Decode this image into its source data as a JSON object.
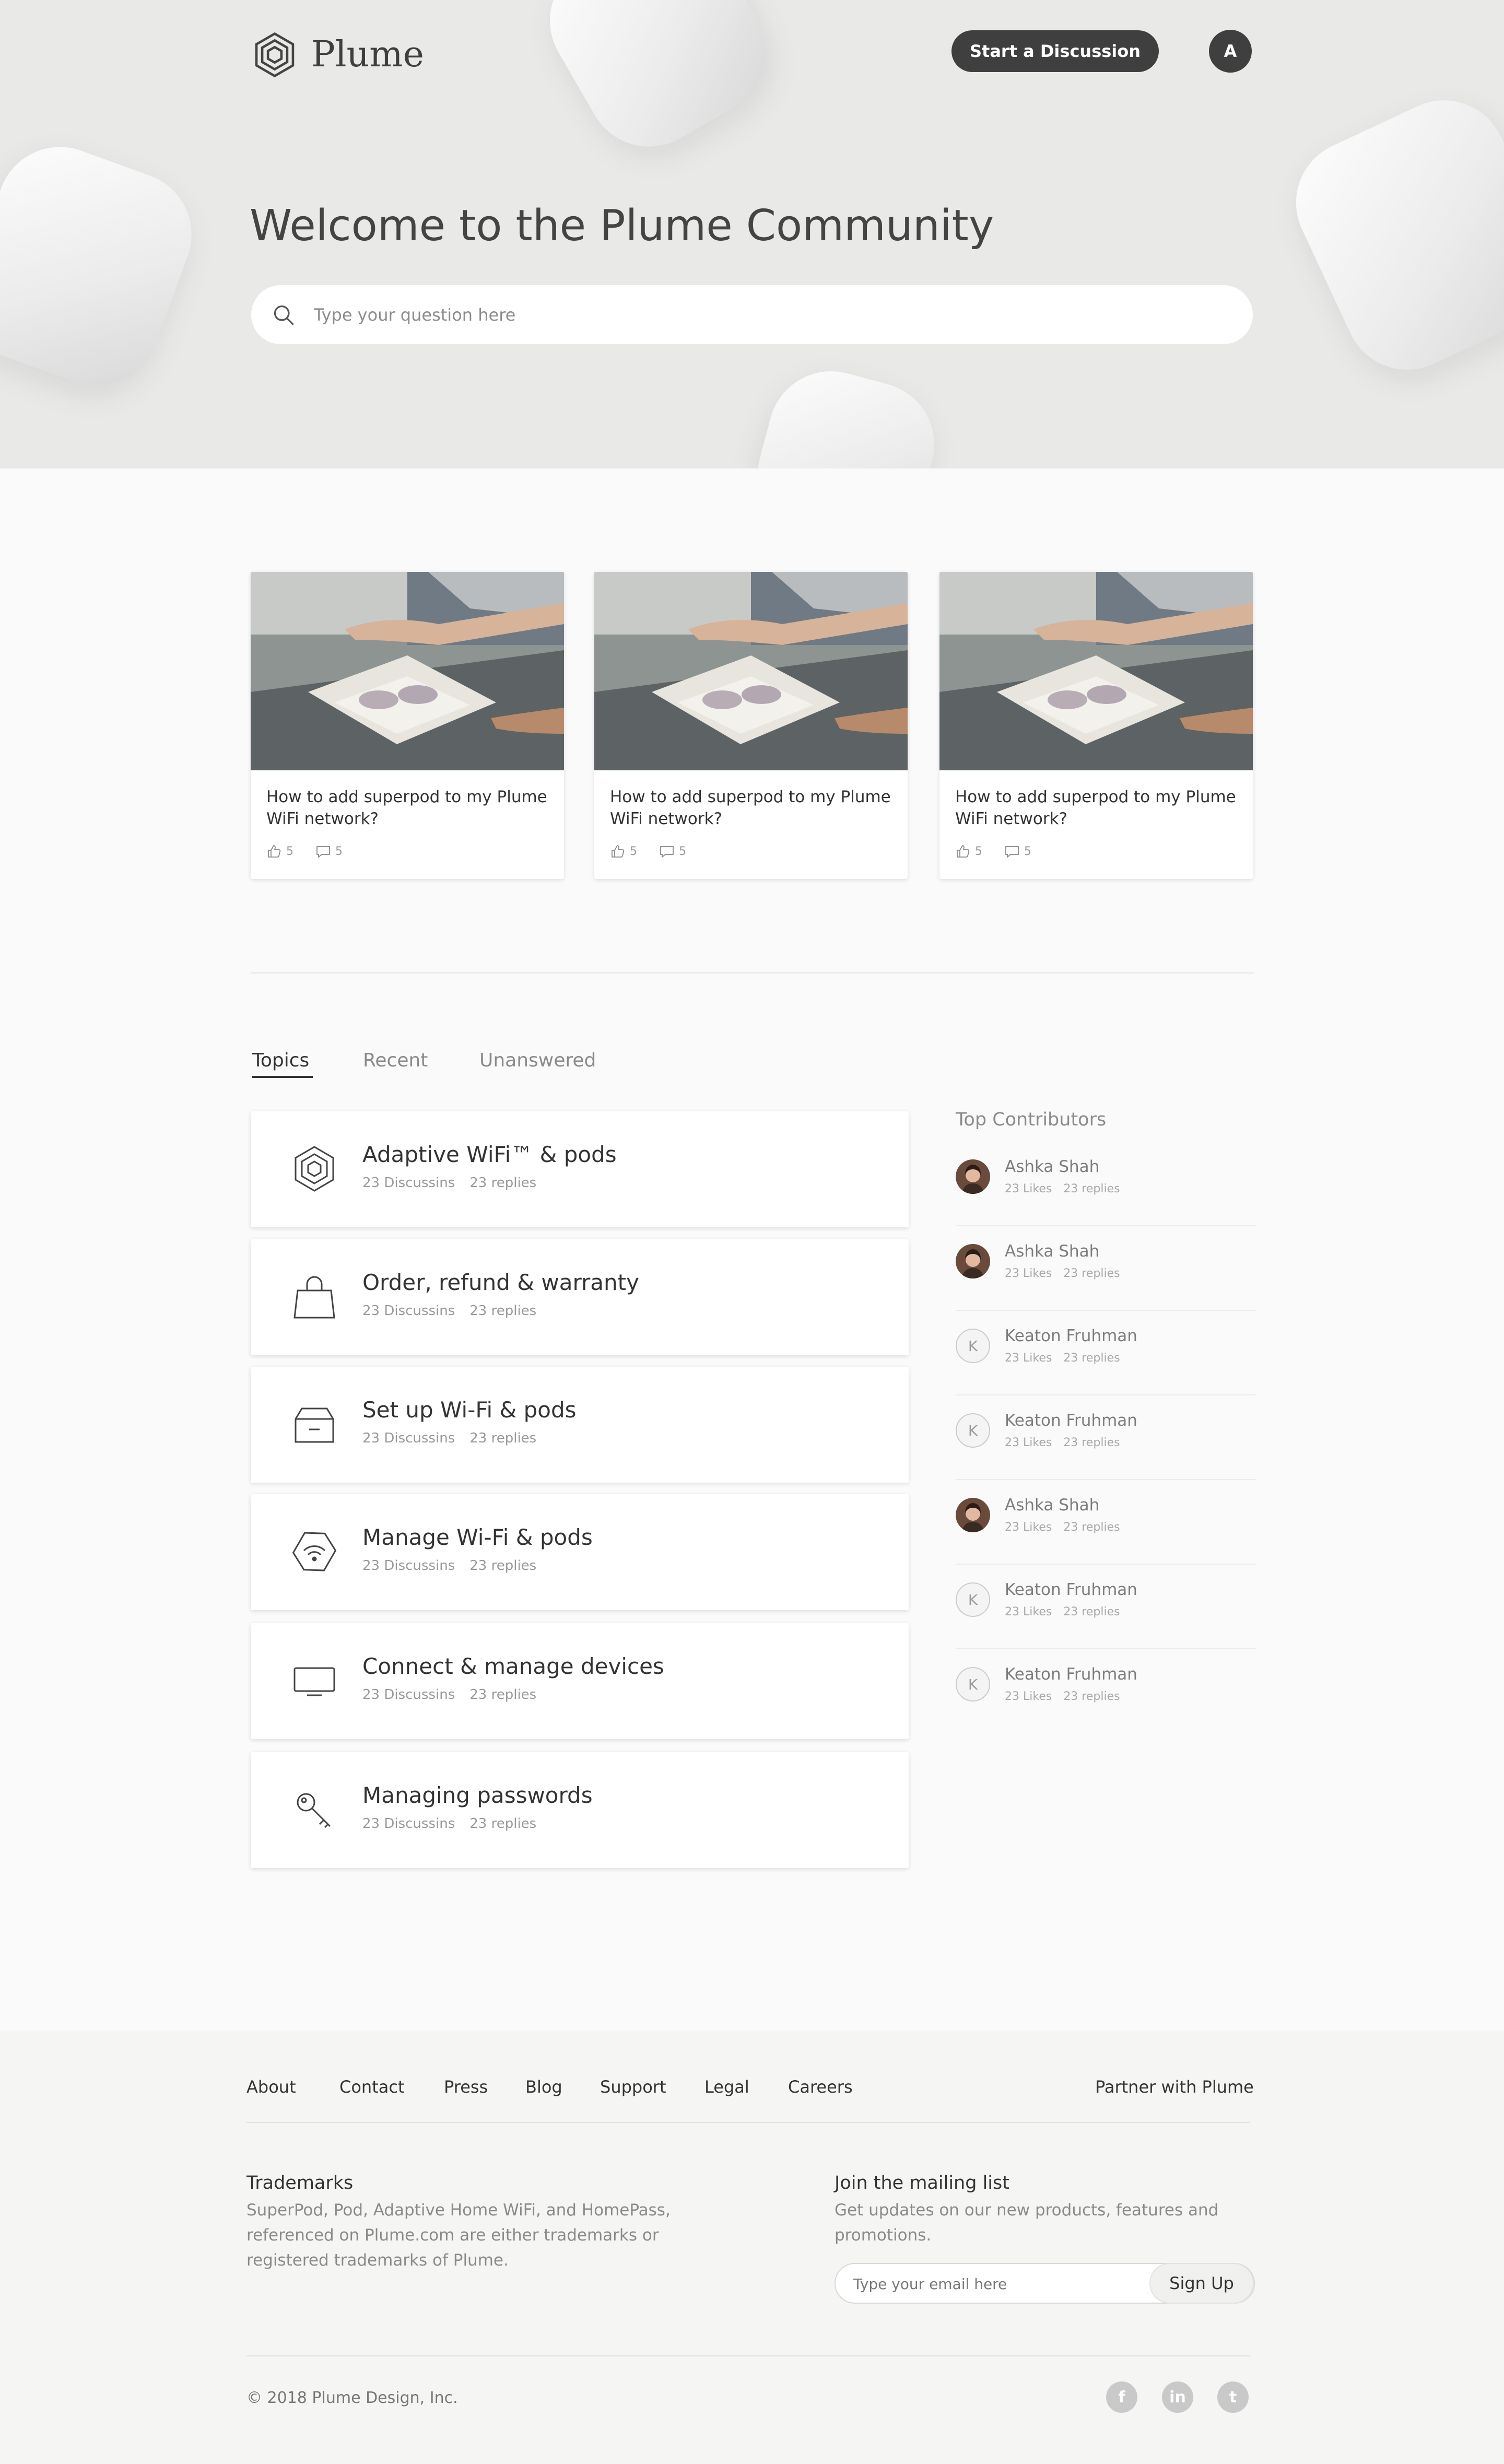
{
  "header": {
    "logo_text": "Plume",
    "start_discussion_label": "Start a Discussion",
    "avatar_initial": "A"
  },
  "hero": {
    "title": "Welcome to the Plume Community",
    "search_placeholder": "Type your question here"
  },
  "featured": [
    {
      "title": "How to add superpod to my Plume WiFi network?",
      "likes": "5",
      "comments": "5"
    },
    {
      "title": "How to add superpod to my Plume WiFi network?",
      "likes": "5",
      "comments": "5"
    },
    {
      "title": "How to add superpod to my Plume WiFi network?",
      "likes": "5",
      "comments": "5"
    }
  ],
  "tabs": [
    "Topics",
    "Recent",
    "Unanswered"
  ],
  "topics": [
    {
      "icon": "plume-logo-icon",
      "title": "Adaptive WiFi™ & pods",
      "discussions": "23 Discussins",
      "replies": "23 replies"
    },
    {
      "icon": "shopping-bag-icon",
      "title": "Order, refund & warranty",
      "discussions": "23 Discussins",
      "replies": "23 replies"
    },
    {
      "icon": "box-icon",
      "title": "Set up Wi-Fi & pods",
      "discussions": "23 Discussins",
      "replies": "23 replies"
    },
    {
      "icon": "wifi-pod-icon",
      "title": "Manage Wi-Fi & pods",
      "discussions": "23 Discussins",
      "replies": "23 replies"
    },
    {
      "icon": "monitor-icon",
      "title": "Connect & manage devices",
      "discussions": "23 Discussins",
      "replies": "23 replies"
    },
    {
      "icon": "key-icon",
      "title": "Managing passwords",
      "discussions": "23 Discussins",
      "replies": "23 replies"
    }
  ],
  "contributors": {
    "title": "Top Contributors",
    "items": [
      {
        "name": "Ashka Shah",
        "likes": "23 Likes",
        "replies": "23 replies",
        "avatar": "photo",
        "initial": ""
      },
      {
        "name": "Ashka Shah",
        "likes": "23 Likes",
        "replies": "23 replies",
        "avatar": "photo",
        "initial": ""
      },
      {
        "name": "Keaton Fruhman",
        "likes": "23 Likes",
        "replies": "23 replies",
        "avatar": "letter",
        "initial": "K"
      },
      {
        "name": "Keaton Fruhman",
        "likes": "23 Likes",
        "replies": "23 replies",
        "avatar": "letter",
        "initial": "K"
      },
      {
        "name": "Ashka Shah",
        "likes": "23 Likes",
        "replies": "23 replies",
        "avatar": "photo",
        "initial": ""
      },
      {
        "name": "Keaton Fruhman",
        "likes": "23 Likes",
        "replies": "23 replies",
        "avatar": "letter",
        "initial": "K"
      },
      {
        "name": "Keaton Fruhman",
        "likes": "23 Likes",
        "replies": "23 replies",
        "avatar": "letter",
        "initial": "K"
      }
    ]
  },
  "footer": {
    "nav": [
      "About",
      "Contact",
      "Press",
      "Blog",
      "Support",
      "Legal",
      "Careers"
    ],
    "partner": "Partner with  Plume",
    "trademarks_title": "Trademarks",
    "trademarks_body": "SuperPod, Pod, Adaptive Home WiFi, and HomePass, referenced on Plume.com are either trademarks or registered trademarks of Plume.",
    "mailing_title": "Join the mailing list",
    "mailing_body": "Get updates on our new products, features and promotions.",
    "email_placeholder": "Type your email here",
    "signup_label": "Sign Up",
    "copyright": "© 2018 Plume Design, Inc.",
    "social": [
      {
        "icon": "facebook-icon",
        "glyph": "f"
      },
      {
        "icon": "linkedin-icon",
        "glyph": "in"
      },
      {
        "icon": "twitter-icon",
        "glyph": "t"
      }
    ]
  },
  "colors": {
    "dark": "#3f3f3f",
    "text": "#333333",
    "muted": "#8a8a8a",
    "hero_bg": "#e9e9e8"
  }
}
